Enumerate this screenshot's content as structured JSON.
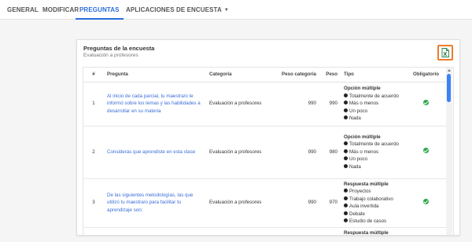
{
  "tabs": {
    "general": "GENERAL",
    "modificar": "MODIFICAR",
    "preguntas": "PREGUNTAS",
    "aplicaciones": "APLICACIONES DE ENCUESTA"
  },
  "card": {
    "title": "Preguntas de la encuesta",
    "subtitle": "Evaluación a profesores",
    "export_icon": "excel-file-icon"
  },
  "table": {
    "headers": {
      "num": "#",
      "pregunta": "Pregunta",
      "categoria": "Categoría",
      "peso_categoria": "Peso categoría",
      "peso": "Peso",
      "tipo": "Tipo",
      "obligatorio": "Obligatorio"
    },
    "rows": [
      {
        "num": "1",
        "pregunta": "Al inicio de cada parcial, tu maestra/o te informó sobre los temas y las habilidades a desarrollar en su materia",
        "categoria": "Evaluación a profesores",
        "peso_categoria": "990",
        "peso": "990",
        "tipo": "Opción múltiple",
        "opciones": [
          "Totalmente de acuerdo",
          "Más o menos",
          "Un poco",
          "Nada"
        ]
      },
      {
        "num": "2",
        "pregunta": "Consideras que aprendiste en esta clase",
        "categoria": "Evaluación a profesores",
        "peso_categoria": "990",
        "peso": "980",
        "tipo": "Opción múltiple",
        "opciones": [
          "Totalmente de acuerdo",
          "Más o menos",
          "Un poco",
          "Nada"
        ]
      },
      {
        "num": "3",
        "pregunta": "De las siguientes metodologías, las que utilizó tu maestra/o para facilitar tu aprendizaje son:",
        "categoria": "Evaluación a profesores",
        "peso_categoria": "990",
        "peso": "970",
        "tipo": "Respuesta múltiple",
        "opciones": [
          "Proyectos",
          "Trabajo colaborativo",
          "Aula invertida",
          "Debate",
          "Estudio de casos"
        ]
      },
      {
        "num": "",
        "pregunta": "",
        "categoria": "",
        "peso_categoria": "",
        "peso": "",
        "tipo": "Respuesta múltiple",
        "opciones": []
      }
    ]
  },
  "colors": {
    "accent": "#2a6fdb",
    "link": "#3b6ed6",
    "export_border": "#f07a2a",
    "check": "#27a744",
    "scroll_thumb": "#3b82f6"
  }
}
